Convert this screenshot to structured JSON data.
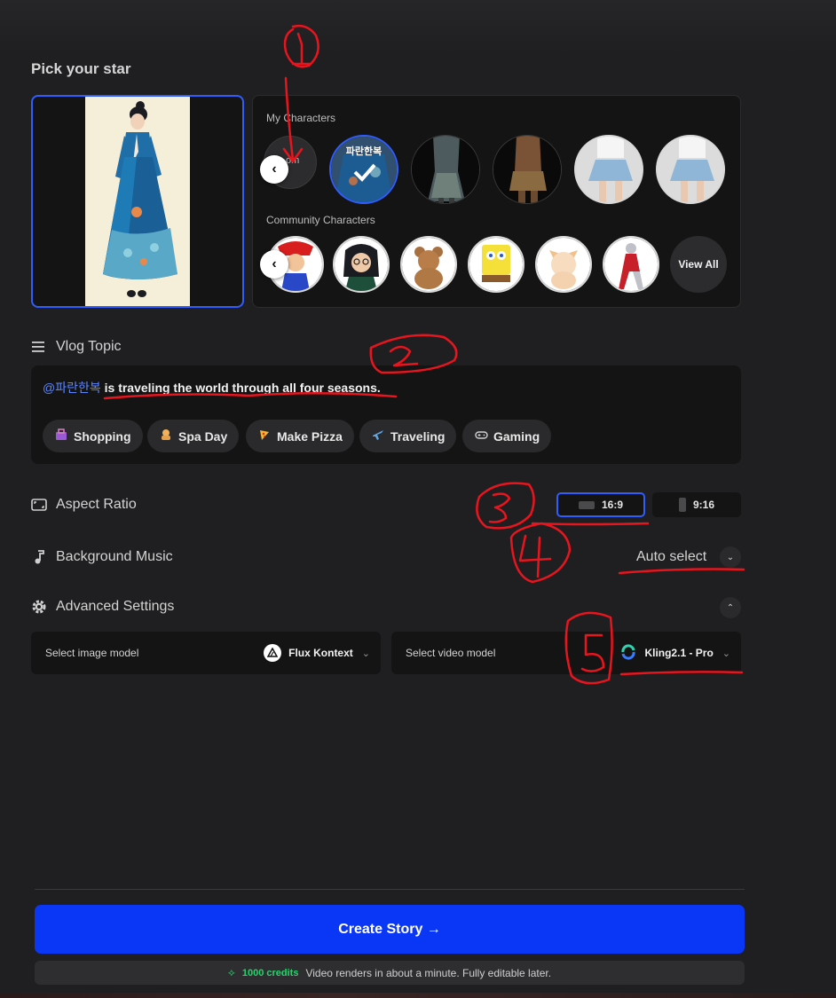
{
  "star": {
    "title": "Pick your star",
    "my_characters_label": "My Characters",
    "community_characters_label": "Community Characters",
    "partial_avatar_text": "om",
    "selected_avatar_caption": "파란한복",
    "view_all_label": "View All"
  },
  "topic": {
    "title": "Vlog Topic",
    "mention": "@파란한복",
    "text": "is traveling the world through all four seasons.",
    "chips": [
      {
        "icon": "shopping-icon",
        "label": "Shopping"
      },
      {
        "icon": "spa-icon",
        "label": "Spa Day"
      },
      {
        "icon": "pizza-icon",
        "label": "Make Pizza"
      },
      {
        "icon": "airplane-icon",
        "label": "Traveling"
      },
      {
        "icon": "gamepad-icon",
        "label": "Gaming"
      }
    ]
  },
  "aspect": {
    "title": "Aspect Ratio",
    "options": [
      "16:9",
      "9:16"
    ],
    "selected": "16:9"
  },
  "music": {
    "title": "Background Music",
    "value": "Auto select"
  },
  "advanced": {
    "title": "Advanced Settings",
    "image_model_label": "Select image model",
    "image_model_value": "Flux Kontext",
    "video_model_label": "Select video model",
    "video_model_value": "Kling2.1 - Pro"
  },
  "footer": {
    "create_label": "Create Story →",
    "credits": "1000 credits",
    "note": "Video renders in about a minute. Fully editable later."
  },
  "colors": {
    "accent": "#2f5dff",
    "create_button": "#0a36f5",
    "credits_green": "#26d36b",
    "annotation_red": "#e8141e"
  }
}
